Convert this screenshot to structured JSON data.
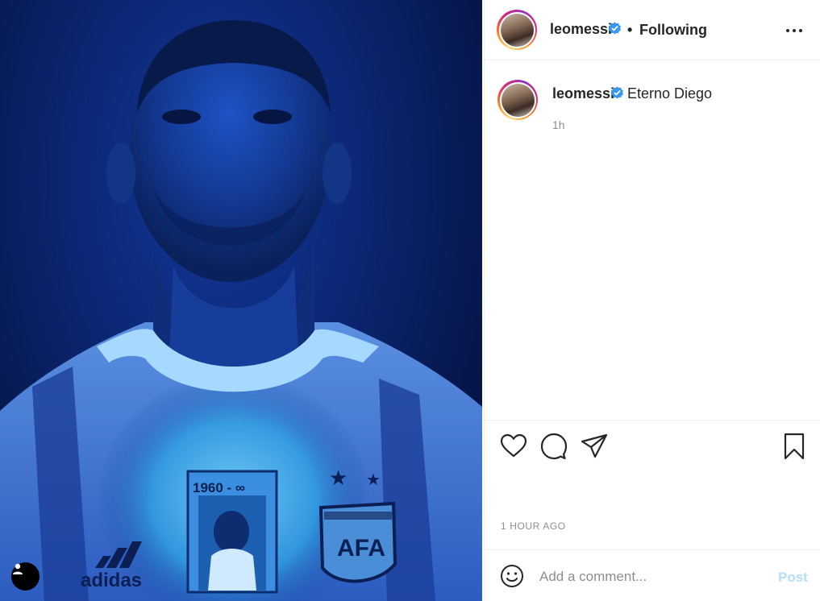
{
  "post": {
    "username": "leomessi",
    "follow_status": "Following",
    "separator": "•",
    "caption": "Eterno Diego",
    "relative_time": "1h",
    "timestamp": "1 HOUR AGO"
  },
  "photo": {
    "shirt_text": "1960 - ∞",
    "brand_text": "adidas",
    "crest_text": "AFA"
  },
  "comment": {
    "placeholder": "Add a comment...",
    "post_label": "Post"
  },
  "icons": {
    "verified": "verified-badge-icon",
    "more": "more-options-icon",
    "like": "heart-icon",
    "comment": "comment-icon",
    "share": "paper-plane-icon",
    "save": "bookmark-icon",
    "emoji": "emoji-icon",
    "tags": "user-tag-icon"
  },
  "colors": {
    "verified_blue": "#3897f0",
    "post_button_disabled": "#b2dffc",
    "photo_tint": "#0b2672"
  }
}
